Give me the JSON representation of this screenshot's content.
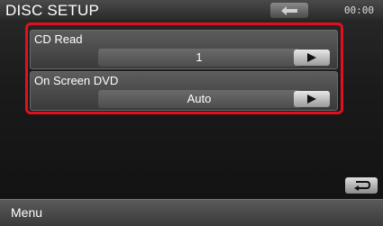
{
  "header": {
    "title": "DISC SETUP",
    "clock": "00:00"
  },
  "settings": [
    {
      "label": "CD Read",
      "value": "1"
    },
    {
      "label": "On Screen DVD",
      "value": "Auto"
    }
  ],
  "footer": {
    "menu_label": "Menu"
  },
  "colors": {
    "highlight": "#e0101f"
  }
}
